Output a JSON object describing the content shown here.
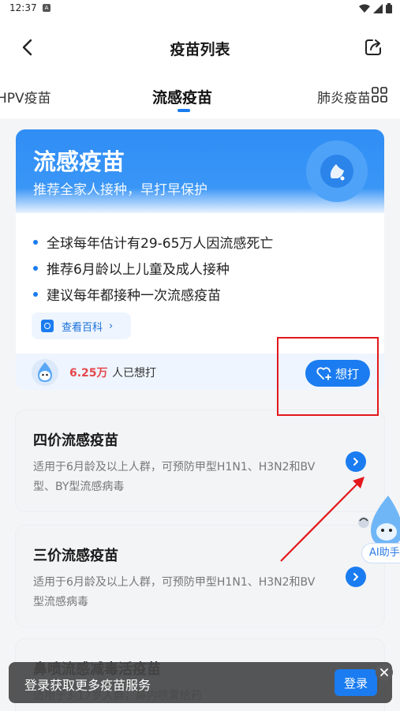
{
  "status_bar": {
    "time": "12:37",
    "notification_icon": "A"
  },
  "header": {
    "title": "疫苗列表",
    "back_icon": "back-arrow-icon",
    "share_icon": "share-icon"
  },
  "tabs": [
    {
      "label": "HPV疫苗"
    },
    {
      "label": "流感疫苗",
      "active": true
    },
    {
      "label": "肺炎疫苗"
    }
  ],
  "hero": {
    "title": "流感疫苗",
    "subtitle": "推荐全家人接种，早打早保护",
    "bullets": [
      "全球每年估计有29-65万人因流感死亡",
      "推荐6月龄以上儿童及成人接种",
      "建议每年都接种一次流感疫苗"
    ],
    "wiki_label": "查看百科",
    "want_count": "6.25万",
    "want_text": "人已想打",
    "want_button": "想打"
  },
  "vaccines": [
    {
      "title": "四价流感疫苗",
      "description": "适用于6月龄及以上人群，可预防甲型H1N1、H3N2和BV型、BY型流感病毒"
    },
    {
      "title": "三价流感疫苗",
      "description": "适用于6月龄及以上人群，可预防甲型H1N1、H3N2和BV型流感病毒"
    },
    {
      "title": "鼻喷流感减毒活疫苗",
      "description": "适用于3-17岁人群，鼻内喷雾给药"
    }
  ],
  "ai_assistant": {
    "label": "AI助手"
  },
  "login_banner": {
    "text": "登录获取更多疫苗服务",
    "button": "登录"
  },
  "colors": {
    "accent": "#1a7cf0",
    "highlight": "#e3171c",
    "count": "#e5474b"
  }
}
